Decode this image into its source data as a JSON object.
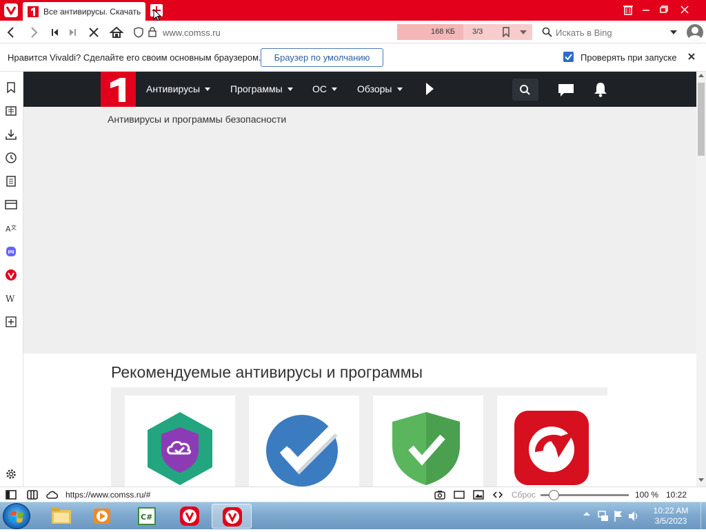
{
  "browser": {
    "tab_title": "Все антивирусы. Скачать бесплатные антивирусы",
    "url": "www.comss.ru",
    "page_size": "168 КБ",
    "page_count": "3/3",
    "search_placeholder": "Искать в Bing",
    "accent_color": "#e3001b"
  },
  "notification": {
    "text": "Нравится Vivaldi? Сделайте его своим основным браузером.",
    "default_button": "Браузер по умолчанию",
    "check_label": "Проверять при запуске"
  },
  "side_panel": {
    "icons": [
      "bookmarks-icon",
      "reading-list-icon",
      "downloads-icon",
      "history-icon",
      "notes-icon",
      "window-panel-icon",
      "translate-icon",
      "mastodon-icon",
      "vivaldi-icon",
      "wikipedia-icon",
      "add-panel-icon",
      "settings-icon"
    ]
  },
  "site": {
    "nav": [
      "Антивирусы",
      "Программы",
      "ОС",
      "Обзоры"
    ],
    "breadcrumb": "Антивирусы и программы безопасности",
    "recommended_title": "Рекомендуемые антивирусы и программы"
  },
  "status_bar": {
    "url": "https://www.comss.ru/#",
    "reset": "Сброс",
    "zoom": "100 %",
    "zoom_fraction": 0.15,
    "time": "10:22 утра"
  },
  "taskbar": {
    "time": "10:22 AM",
    "date": "3/5/2023"
  }
}
